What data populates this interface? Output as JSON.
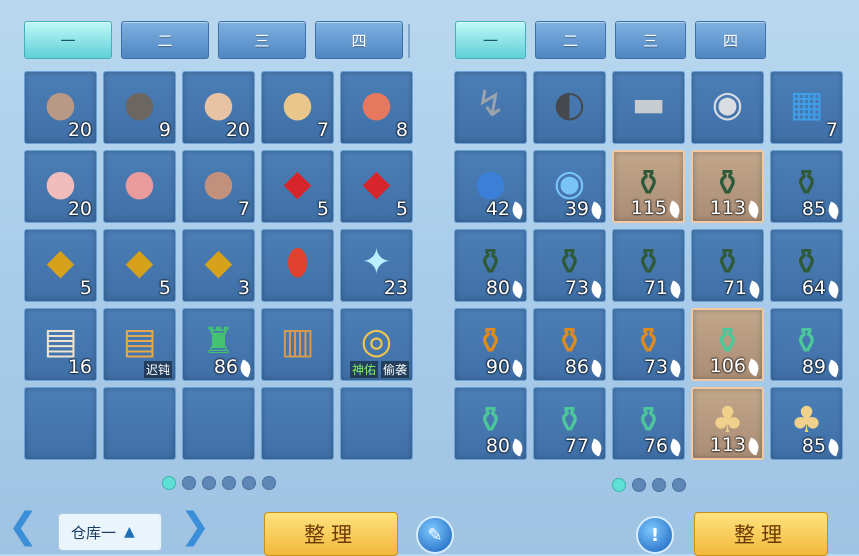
{
  "left_panel": {
    "tabs": [
      "一",
      "二",
      "三",
      "四"
    ],
    "active_tab": 0,
    "slots": [
      {
        "item": "dumpling-plate-dark",
        "icon": "●",
        "color": "#b89986",
        "qty": "20"
      },
      {
        "item": "dumpling-plate-black",
        "icon": "●",
        "color": "#6c6660",
        "qty": "9"
      },
      {
        "item": "dumpling-plate-flower",
        "icon": "●",
        "color": "#e7c3a3",
        "qty": "20"
      },
      {
        "item": "dumpling-plate-golden",
        "icon": "●",
        "color": "#e9c78c",
        "qty": "7"
      },
      {
        "item": "dumpling-plate-red",
        "icon": "●",
        "color": "#e6785f",
        "qty": "8"
      },
      {
        "item": "dumpling-plate-pink",
        "icon": "●",
        "color": "#f0bcbc",
        "qty": "20"
      },
      {
        "item": "dumpling-plate-rose",
        "icon": "●",
        "color": "#e99b9b",
        "qty": ""
      },
      {
        "item": "dumpling-plate-brown",
        "icon": "●",
        "color": "#c3907e",
        "qty": "7"
      },
      {
        "item": "red-lucky-bag",
        "icon": "◆",
        "color": "#d7262b",
        "qty": "5"
      },
      {
        "item": "red-lucky-bag",
        "icon": "◆",
        "color": "#d7262b",
        "qty": "5"
      },
      {
        "item": "gold-lucky-bag",
        "icon": "◆",
        "color": "#d6a21c",
        "qty": "5"
      },
      {
        "item": "gold-lucky-bag",
        "icon": "◆",
        "color": "#d6a21c",
        "qty": "5"
      },
      {
        "item": "gold-lucky-bag",
        "icon": "◆",
        "color": "#d6a21c",
        "qty": "3"
      },
      {
        "item": "red-talisman-gem",
        "icon": "⬮",
        "color": "#e0412e",
        "qty": ""
      },
      {
        "item": "crystal-shard-tray",
        "icon": "✦",
        "color": "#b9f0ff",
        "qty": "23"
      },
      {
        "item": "white-scroll",
        "icon": "▤",
        "color": "#efe4cf",
        "qty": "16"
      },
      {
        "item": "gold-scroll",
        "icon": "▤",
        "color": "#e6a84a",
        "qty": "",
        "tags": [
          "迟钝"
        ]
      },
      {
        "item": "green-potion-bottle",
        "icon": "♜",
        "color": "#43c272",
        "qty": "86",
        "leaf": true
      },
      {
        "item": "brown-scroll",
        "icon": "▥",
        "color": "#d89a4e",
        "qty": ""
      },
      {
        "item": "amulet-necklace",
        "icon": "◎",
        "color": "#f0c64a",
        "qty": "",
        "tags": [
          "神佑",
          "偷袭"
        ],
        "tag_green": true
      },
      {
        "item": "",
        "icon": "",
        "color": "",
        "qty": ""
      },
      {
        "item": "",
        "icon": "",
        "color": "",
        "qty": ""
      },
      {
        "item": "",
        "icon": "",
        "color": "",
        "qty": ""
      },
      {
        "item": "",
        "icon": "",
        "color": "",
        "qty": ""
      },
      {
        "item": "",
        "icon": "",
        "color": "",
        "qty": ""
      }
    ],
    "page_dots": 6,
    "active_dot": 0
  },
  "right_panel": {
    "tabs": [
      "一",
      "二",
      "三",
      "四"
    ],
    "active_tab": 0,
    "slots": [
      {
        "item": "fishing-rod",
        "icon": "↯",
        "color": "#9aa4ae",
        "qty": ""
      },
      {
        "item": "black-sack",
        "icon": "◐",
        "color": "#45484c",
        "qty": ""
      },
      {
        "item": "iron-bar",
        "icon": "▬",
        "color": "#c7ccd1",
        "qty": ""
      },
      {
        "item": "silver-bell",
        "icon": "◉",
        "color": "#d9dde2",
        "qty": ""
      },
      {
        "item": "blue-book",
        "icon": "▦",
        "color": "#3f9ee8",
        "qty": "7"
      },
      {
        "item": "dark-blue-orb",
        "icon": "●",
        "color": "#3c7fd9",
        "qty": "42",
        "leaf": true
      },
      {
        "item": "swirl-orb",
        "icon": "◉",
        "color": "#78c4f7",
        "qty": "39",
        "leaf": true
      },
      {
        "item": "green-wine-jar",
        "icon": "⚱",
        "color": "#2f5a3a",
        "qty": "115",
        "leaf": true,
        "hi": true
      },
      {
        "item": "green-wine-jar",
        "icon": "⚱",
        "color": "#2f5a3a",
        "qty": "113",
        "leaf": true,
        "hi": true
      },
      {
        "item": "green-wine-jar",
        "icon": "⚱",
        "color": "#2f5a3a",
        "qty": "85",
        "leaf": true
      },
      {
        "item": "green-wine-jar",
        "icon": "⚱",
        "color": "#2f5a3a",
        "qty": "80",
        "leaf": true
      },
      {
        "item": "green-wine-jar",
        "icon": "⚱",
        "color": "#2f5a3a",
        "qty": "73",
        "leaf": true
      },
      {
        "item": "green-wine-jar",
        "icon": "⚱",
        "color": "#2f5a3a",
        "qty": "71",
        "leaf": true
      },
      {
        "item": "green-wine-jar",
        "icon": "⚱",
        "color": "#2f5a3a",
        "qty": "71",
        "leaf": true
      },
      {
        "item": "green-wine-jar",
        "icon": "⚱",
        "color": "#2f5a3a",
        "qty": "64",
        "leaf": true
      },
      {
        "item": "orange-jar",
        "icon": "⚱",
        "color": "#e08a1e",
        "qty": "90",
        "leaf": true
      },
      {
        "item": "orange-jar",
        "icon": "⚱",
        "color": "#e08a1e",
        "qty": "86",
        "leaf": true
      },
      {
        "item": "orange-jar",
        "icon": "⚱",
        "color": "#e08a1e",
        "qty": "73",
        "leaf": true
      },
      {
        "item": "jade-pot",
        "icon": "⚱",
        "color": "#4cc79a",
        "qty": "106",
        "leaf": true,
        "hi": true
      },
      {
        "item": "jade-pot",
        "icon": "⚱",
        "color": "#4cc79a",
        "qty": "89",
        "leaf": true
      },
      {
        "item": "jade-pot",
        "icon": "⚱",
        "color": "#4cc79a",
        "qty": "80",
        "leaf": true
      },
      {
        "item": "jade-pot",
        "icon": "⚱",
        "color": "#4cc79a",
        "qty": "77",
        "leaf": true
      },
      {
        "item": "jade-pot",
        "icon": "⚱",
        "color": "#4cc79a",
        "qty": "76",
        "leaf": true
      },
      {
        "item": "gold-gourd",
        "icon": "♣",
        "color": "#f0d08a",
        "qty": "113",
        "leaf": true,
        "hi": true
      },
      {
        "item": "gold-gourd",
        "icon": "♣",
        "color": "#f0d08a",
        "qty": "85",
        "leaf": true
      }
    ],
    "page_dots": 4,
    "active_dot": 0
  },
  "bottom": {
    "warehouse_label": "仓库一",
    "sort_label_left": "整理",
    "sort_label_right": "整理",
    "edit_icon": "✎",
    "info_icon": "!"
  }
}
